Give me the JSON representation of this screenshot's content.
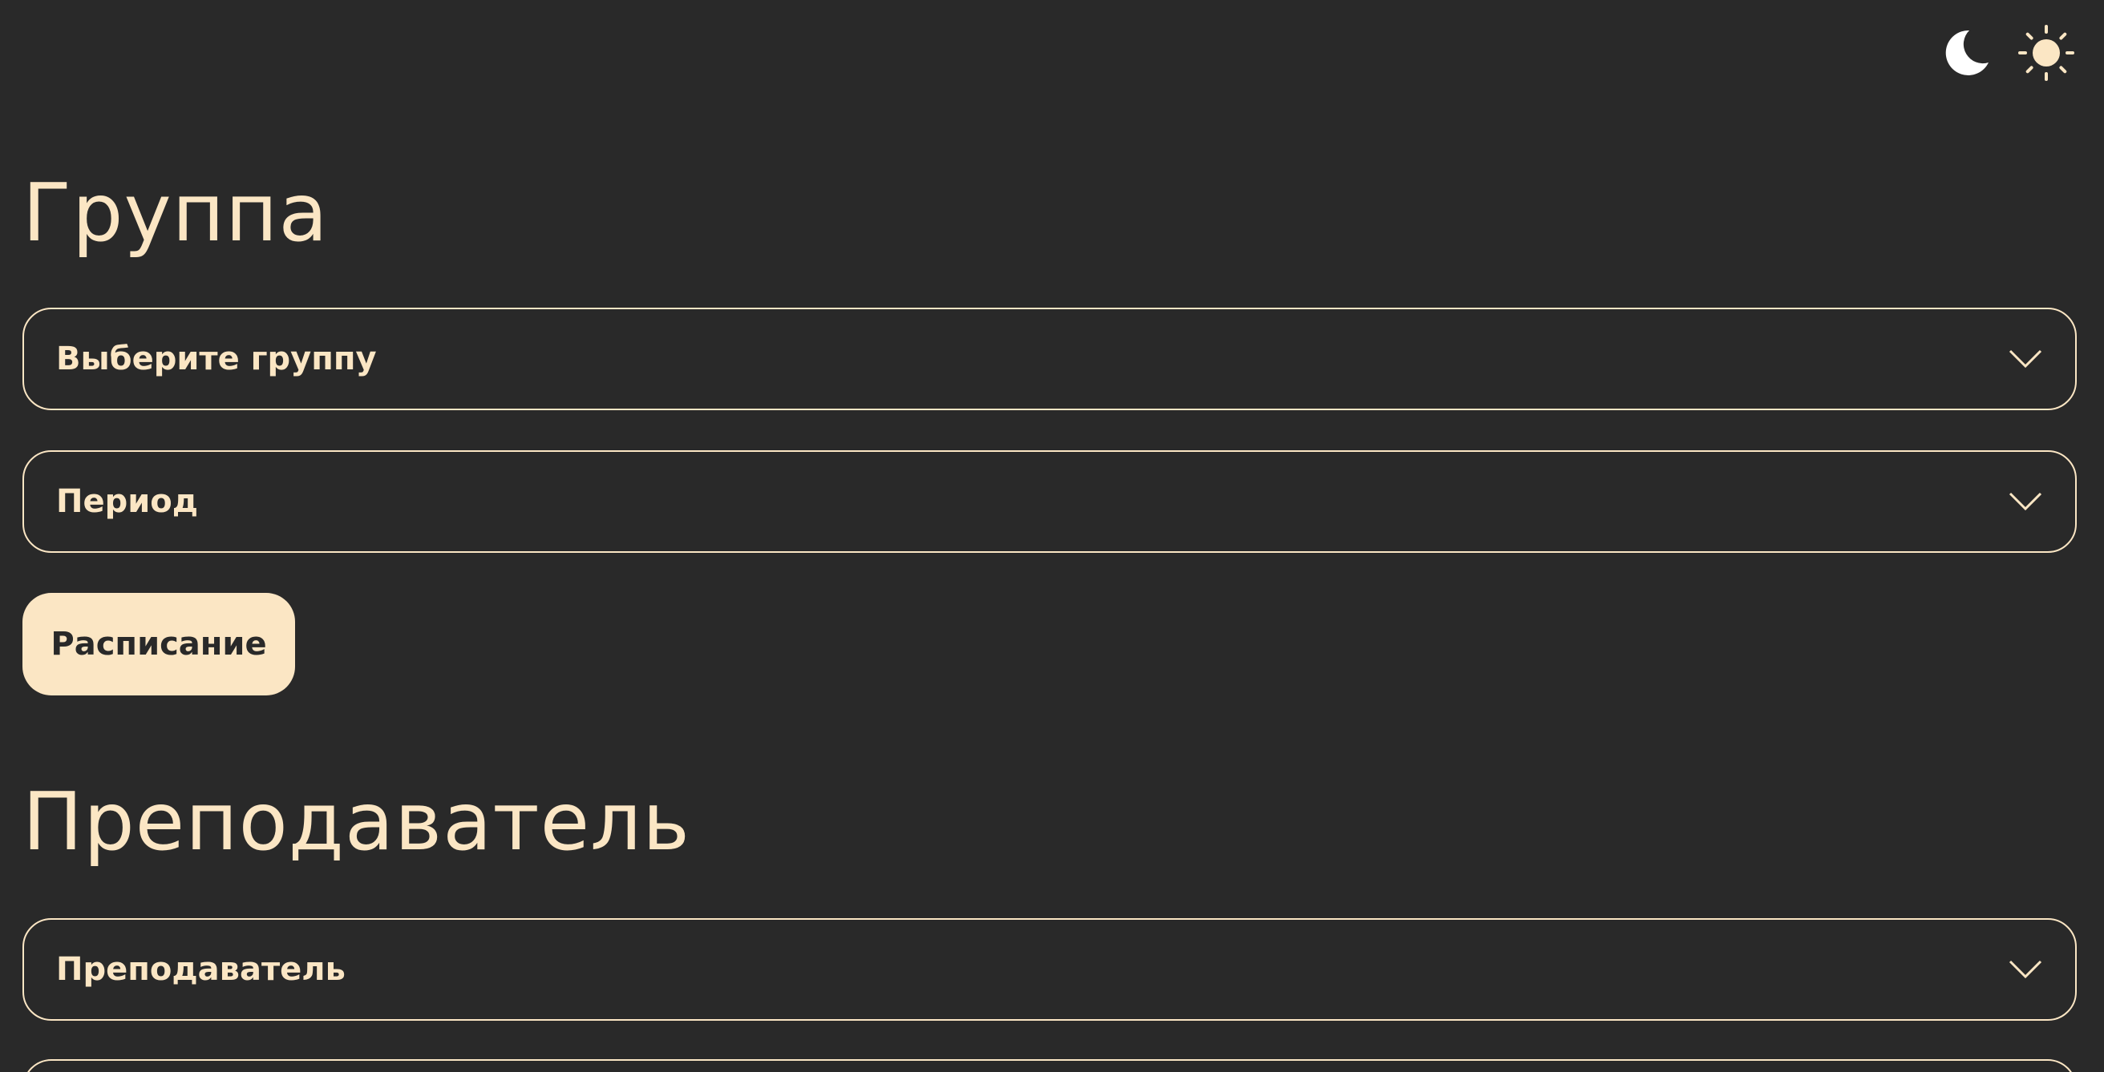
{
  "theme_toggle": {
    "dark_icon": "moon-icon",
    "light_icon": "sun-icon"
  },
  "group_section": {
    "title": "Группа",
    "group_select_placeholder": "Выберите группу",
    "period_select_placeholder": "Период",
    "schedule_button_label": "Расписание"
  },
  "teacher_section": {
    "title": "Преподаватель",
    "teacher_select_placeholder": "Преподаватель"
  },
  "colors": {
    "background": "#292929",
    "accent": "#fbe6c4"
  }
}
